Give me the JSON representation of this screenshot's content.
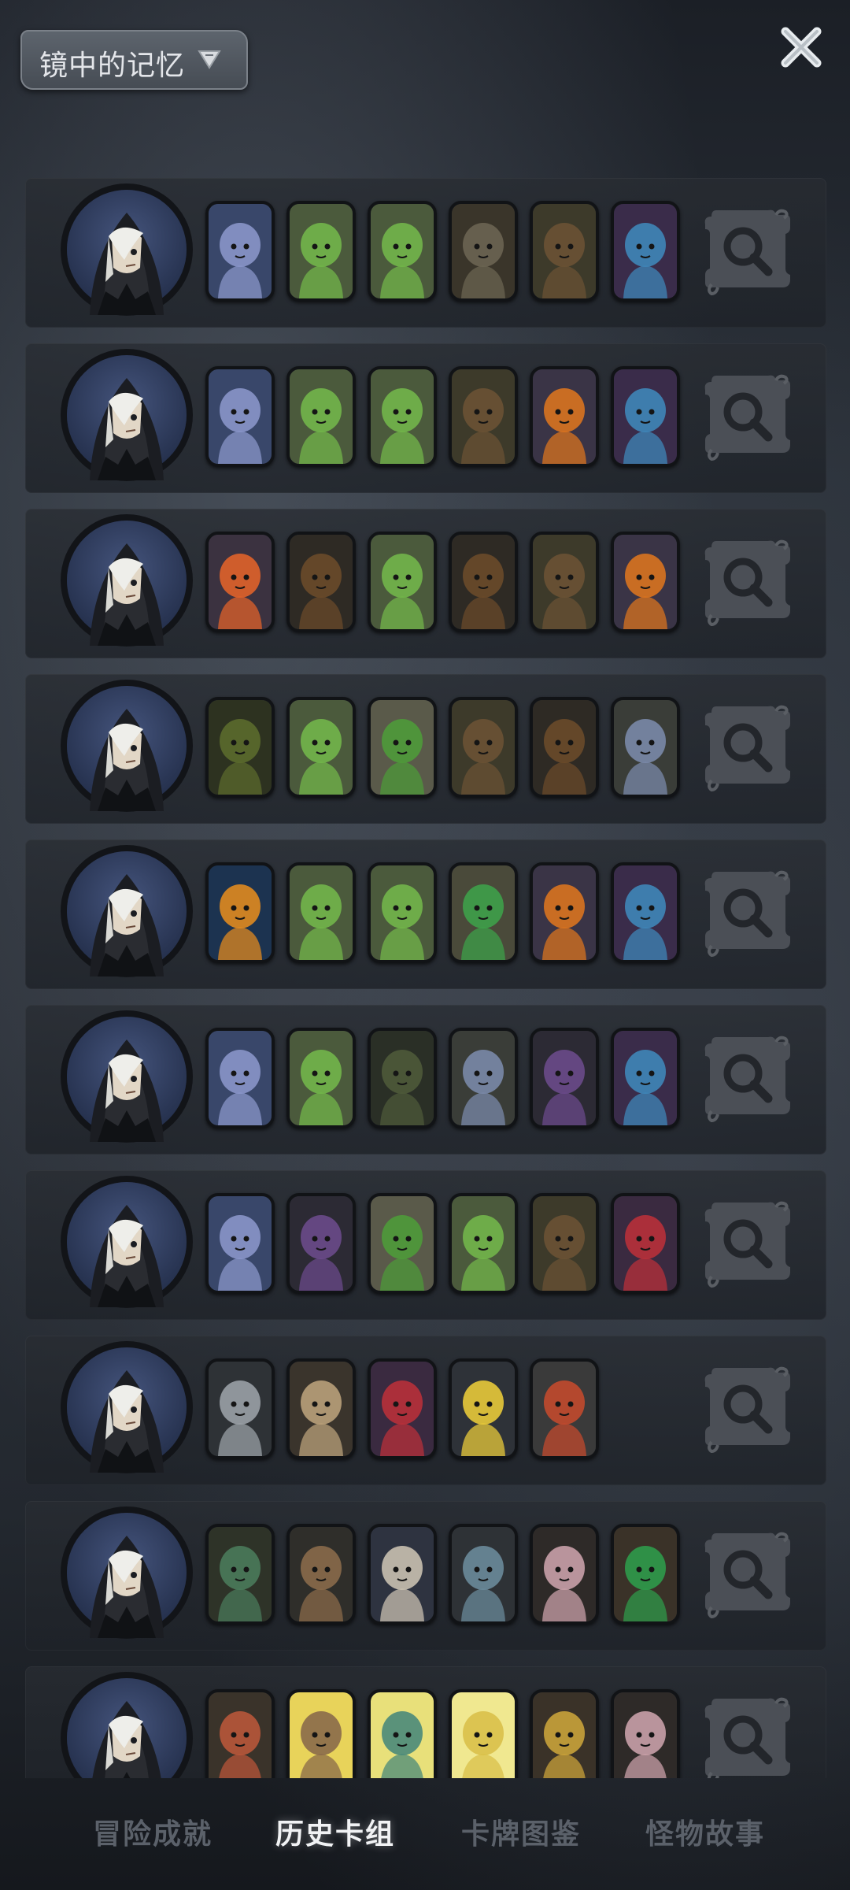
{
  "header": {
    "title": "镜中的记忆",
    "dropdown_icon": "triangle-down-icon",
    "close_icon": "close-x-icon"
  },
  "deck_rows": [
    {
      "hero": "hooded-hero-portrait",
      "cards": [
        "ice-dragon",
        "leaf-sprout",
        "leaf-sprout",
        "scarecrow",
        "mushroom-witch",
        "elf-sorceress"
      ]
    },
    {
      "hero": "hooded-hero-portrait",
      "cards": [
        "ice-dragon",
        "leaf-sprout",
        "leaf-sprout",
        "mushroom-witch",
        "pumpkin-jester",
        "elf-sorceress"
      ]
    },
    {
      "hero": "hooded-hero-portrait",
      "cards": [
        "fire-bear",
        "treant",
        "leaf-sprout",
        "treant",
        "mushroom-witch",
        "pumpkin-jester"
      ]
    },
    {
      "hero": "hooded-hero-portrait",
      "cards": [
        "green-treant",
        "leaf-sprout",
        "leaf-elder",
        "mushroom-witch",
        "treant",
        "mushroom-spider"
      ]
    },
    {
      "hero": "hooded-hero-portrait",
      "cards": [
        "jack-o-lantern",
        "leaf-sprout",
        "leaf-sprout",
        "leaf-dryad",
        "pumpkin-jester",
        "elf-sorceress"
      ]
    },
    {
      "hero": "hooded-hero-portrait",
      "cards": [
        "ice-dragon",
        "leaf-sprout",
        "swamp-blob",
        "mushroom-spider",
        "shadow-serpent",
        "elf-sorceress"
      ]
    },
    {
      "hero": "hooded-hero-portrait",
      "cards": [
        "ice-dragon",
        "shadow-serpent",
        "leaf-elder",
        "leaf-sprout",
        "mushroom-witch",
        "jester-queen"
      ]
    },
    {
      "hero": "hooded-hero-portrait",
      "cards": [
        "steel-turret",
        "rocket-blast",
        "jester-queen",
        "lightning-cannon",
        "iron-golem"
      ]
    },
    {
      "hero": "hooded-hero-portrait",
      "cards": [
        "crocodile-brute",
        "barbarian",
        "bird-bard",
        "lizard-warrior",
        "rat-pirate",
        "mouse-ranger"
      ]
    },
    {
      "hero": "hooded-hero-portrait",
      "cards": [
        "dwarf-warrior",
        "armored-knight",
        "holy-shield",
        "lightning-mage",
        "monk-fighter",
        "rat-pirate"
      ]
    }
  ],
  "card_palette": {
    "ice-dragon": [
      "#8a95c9",
      "#39476a"
    ],
    "leaf-sprout": [
      "#72b54a",
      "#4b5a3c"
    ],
    "scarecrow": [
      "#6b6452",
      "#3a352a"
    ],
    "mushroom-witch": [
      "#6a5234",
      "#3d3a2a"
    ],
    "elf-sorceress": [
      "#3f86b8",
      "#3a2c4a"
    ],
    "pumpkin-jester": [
      "#d9731f",
      "#3a3446"
    ],
    "fire-bear": [
      "#e0622a",
      "#3b3240"
    ],
    "treant": [
      "#6a4a2a",
      "#2e2a24"
    ],
    "green-treant": [
      "#5b6a2c",
      "#2d3220"
    ],
    "leaf-elder": [
      "#4e9a3a",
      "#5a5a4a"
    ],
    "leaf-dryad": [
      "#3ea04a",
      "#4a4a3a"
    ],
    "mushroom-spider": [
      "#7a88a8",
      "#3a3d38"
    ],
    "jack-o-lantern": [
      "#e08a1f",
      "#1c3350"
    ],
    "swamp-blob": [
      "#4e5a3a",
      "#2a2f26"
    ],
    "shadow-serpent": [
      "#6a4a8a",
      "#2c2a34"
    ],
    "jester-queen": [
      "#b8303a",
      "#3a2a40"
    ],
    "steel-turret": [
      "#9aa0a6",
      "#2e3236"
    ],
    "rocket-blast": [
      "#b9a07a",
      "#3a342c"
    ],
    "lightning-cannon": [
      "#e8c93a",
      "#2e3238"
    ],
    "iron-golem": [
      "#c24a2e",
      "#3a3a3a"
    ],
    "crocodile-brute": [
      "#4a7a5a",
      "#2e3328"
    ],
    "barbarian": [
      "#8a6a4a",
      "#2f2e2a"
    ],
    "bird-bard": [
      "#c9c0b0",
      "#2e3340"
    ],
    "lizard-warrior": [
      "#6a8a9a",
      "#2e3236"
    ],
    "rat-pirate": [
      "#c9a0a8",
      "#2e2a28"
    ],
    "mouse-ranger": [
      "#2f9a4a",
      "#3a3228"
    ],
    "dwarf-warrior": [
      "#b8563a",
      "#3a332a"
    ],
    "armored-knight": [
      "#8a6a4a",
      "#e8d35a"
    ],
    "holy-shield": [
      "#4a8a7a",
      "#e8e07a"
    ],
    "lightning-mage": [
      "#d9c04a",
      "#f0e890"
    ],
    "monk-fighter": [
      "#c9a23a",
      "#3a3228"
    ]
  },
  "action_icon": "magnifier-search-icon",
  "bottom_nav": {
    "tabs": [
      {
        "label": "冒险成就",
        "active": false
      },
      {
        "label": "历史卡组",
        "active": true
      },
      {
        "label": "卡牌图鉴",
        "active": false
      },
      {
        "label": "怪物故事",
        "active": false
      }
    ]
  }
}
